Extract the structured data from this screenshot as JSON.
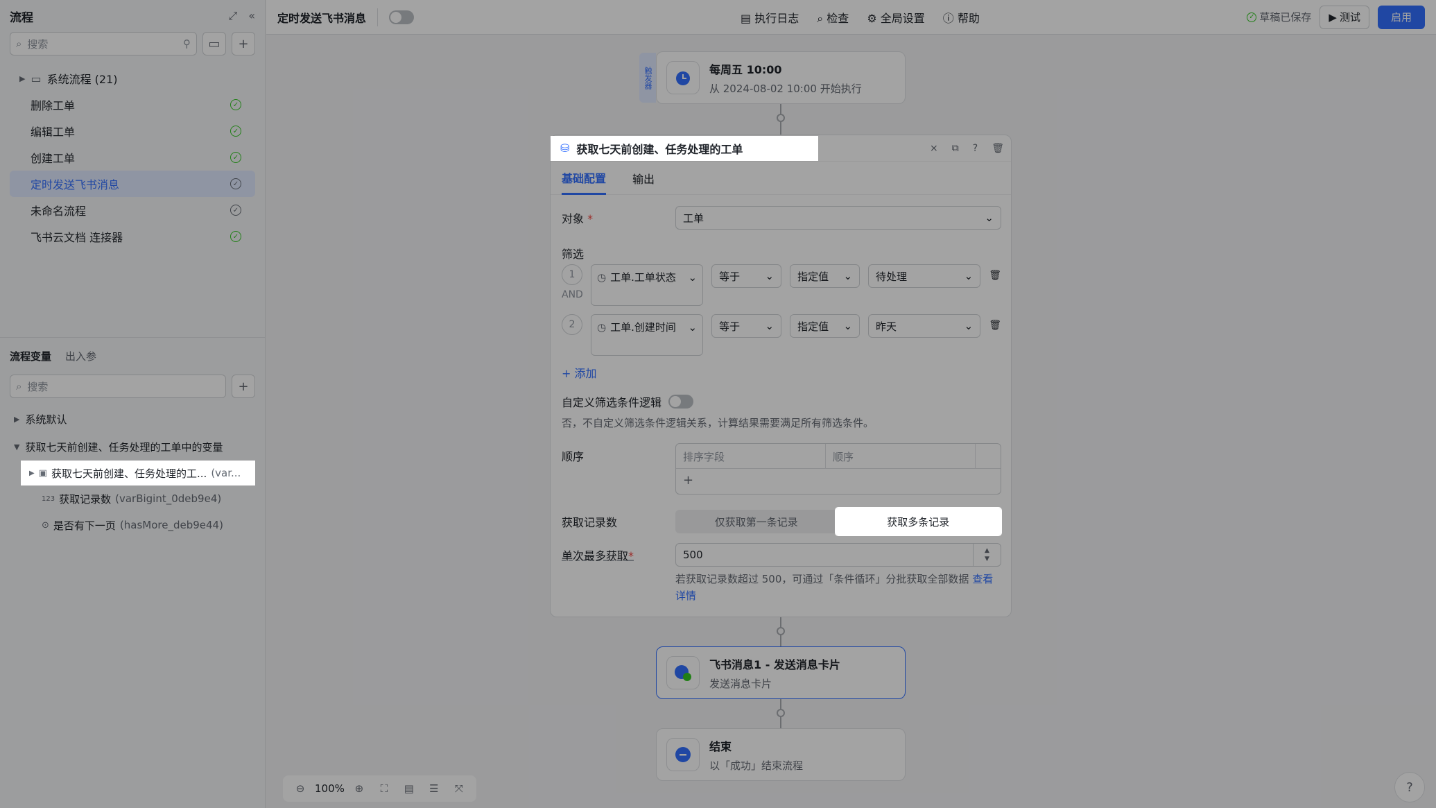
{
  "sidebar": {
    "title": "流程",
    "search_placeholder": "搜索",
    "folder_label": "系统流程 (21)",
    "items": [
      {
        "label": "删除工单",
        "status": "ok"
      },
      {
        "label": "编辑工单",
        "status": "ok"
      },
      {
        "label": "创建工单",
        "status": "ok"
      },
      {
        "label": "定时发送飞书消息",
        "status": "draft"
      },
      {
        "label": "未命名流程",
        "status": "draft"
      },
      {
        "label": "飞书云文档 连接器",
        "status": "ok"
      }
    ],
    "vars_tab_active": "流程变量",
    "vars_tab_other": "出入参",
    "vars_search_placeholder": "搜索",
    "group_system": "系统默认",
    "group_node": "获取七天前创建、任务处理的工单中的变量",
    "var_main": "获取七天前创建、任务处理的工...",
    "var_main_suffix": "(var...",
    "var_count_prefix": "123",
    "var_count_name": "获取记录数",
    "var_count_id": "(varBigint_0deb9e4)",
    "var_more_name": "是否有下一页",
    "var_more_id": "(hasMore_deb9e44)"
  },
  "topbar": {
    "flow_name": "定时发送飞书消息",
    "exec_log": "执行日志",
    "inspect": "检查",
    "global_settings": "全局设置",
    "help": "帮助",
    "saved": "草稿已保存",
    "test": "测试",
    "enable": "启用"
  },
  "canvas": {
    "trigger_tag": "触发器",
    "trigger_title": "每周五 10:00",
    "trigger_sub": "从 2024-08-02 10:00 开始执行",
    "msg_title": "飞书消息1 - 发送消息卡片",
    "msg_sub": "发送消息卡片",
    "end_title": "结束",
    "end_sub": "以「成功」结束流程",
    "zoom": "100%"
  },
  "panel": {
    "title": "获取七天前创建、任务处理的工单",
    "tab_basic": "基础配置",
    "tab_output": "输出",
    "object_label": "对象",
    "object_value": "工单",
    "filter_label": "筛选",
    "filters": [
      {
        "idx": "1",
        "field": "工单.工单状态",
        "op": "等于",
        "mode": "指定值",
        "value": "待处理"
      },
      {
        "idx": "2",
        "field": "工单.创建时间",
        "op": "等于",
        "mode": "指定值",
        "value": "昨天"
      }
    ],
    "and_label": "AND",
    "add_label": "添加",
    "custom_logic_label": "自定义筛选条件逻辑",
    "custom_logic_desc": "否，不自定义筛选条件逻辑关系，计算结果需要满足所有筛选条件。",
    "order_label": "顺序",
    "order_col1": "排序字段",
    "order_col2": "顺序",
    "records_label": "获取记录数",
    "records_opt1": "仅获取第一条记录",
    "records_opt2": "获取多条记录",
    "max_label": "单次最多获取",
    "max_value": "500",
    "max_hint": "若获取记录数超过 500，可通过「条件循环」分批获取全部数据",
    "max_link": "查看详情"
  }
}
